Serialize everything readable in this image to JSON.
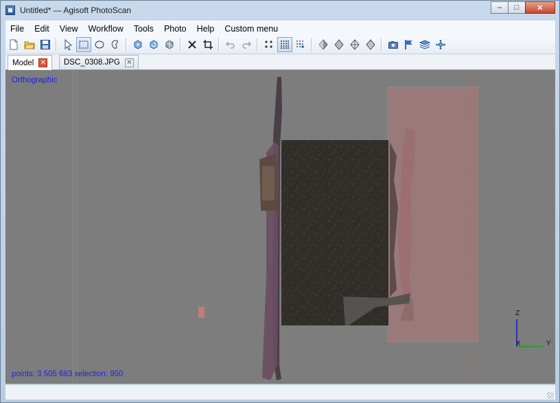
{
  "window": {
    "title": "Untitled* — Agisoft PhotoScan",
    "controls": {
      "minimize": "–",
      "maximize": "□",
      "close": "✕"
    }
  },
  "menu": [
    "File",
    "Edit",
    "View",
    "Workflow",
    "Tools",
    "Photo",
    "Help",
    "Custom menu"
  ],
  "toolbar": {
    "buttons": [
      "new-icon",
      "open-icon",
      "save-icon",
      "navigation-icon",
      "rectangle-selection-icon",
      "circle-selection-icon",
      "free-form-selection-icon",
      "resize-region-icon",
      "rotate-region-icon",
      "rotate-object-icon",
      "delete-selection-icon",
      "crop-selection-icon",
      "undo-icon",
      "redo-icon",
      "point-cloud-icon",
      "dense-cloud-icon",
      "dense-cloud-classes-icon",
      "shaded-model-icon",
      "solid-model-icon",
      "wireframe-model-icon",
      "textured-model-icon",
      "show-cameras-icon",
      "show-markers-icon",
      "show-shapes-icon",
      "show-region-icon"
    ],
    "active": [
      "rectangle-selection-icon",
      "dense-cloud-icon"
    ]
  },
  "tabs": [
    {
      "label": "Model",
      "active": true
    },
    {
      "label": "DSC_0308.JPG",
      "active": false
    }
  ],
  "viewport": {
    "projection": "Orthographic",
    "status": "points: 3 505 683 selection: 950",
    "axes": {
      "z": "Z",
      "x": "X",
      "y": "Y"
    },
    "colors": {
      "background": "#7d7d7d",
      "region": "#b07676",
      "overlay_text": "#1b22e6"
    }
  }
}
